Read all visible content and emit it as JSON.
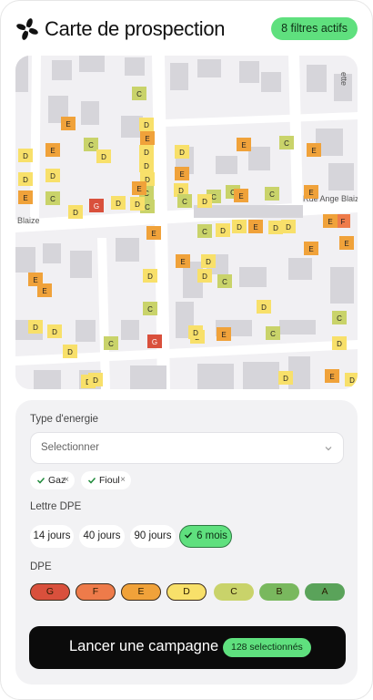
{
  "header": {
    "title": "Carte de prospection",
    "filters_badge": "8 filtres actifs"
  },
  "map": {
    "street_labels": [
      "Rue Ange Blaize",
      "Blaize",
      "ette"
    ],
    "building_tags": [
      {
        "letter": "C"
      },
      {
        "letter": "E"
      },
      {
        "letter": "C"
      },
      {
        "letter": "D"
      },
      {
        "letter": "E"
      },
      {
        "letter": "D"
      },
      {
        "letter": "D"
      },
      {
        "letter": "D"
      },
      {
        "letter": "D"
      },
      {
        "letter": "C"
      },
      {
        "letter": "C"
      },
      {
        "letter": "D"
      },
      {
        "letter": "E"
      },
      {
        "letter": "E"
      },
      {
        "letter": "D"
      },
      {
        "letter": "C"
      },
      {
        "letter": "D"
      },
      {
        "letter": "D"
      },
      {
        "letter": "E"
      },
      {
        "letter": "D"
      },
      {
        "letter": "C"
      },
      {
        "letter": "E"
      },
      {
        "letter": "D"
      },
      {
        "letter": "G"
      },
      {
        "letter": "D"
      },
      {
        "letter": "D"
      },
      {
        "letter": "C"
      },
      {
        "letter": "C"
      },
      {
        "letter": "E"
      },
      {
        "letter": "C"
      },
      {
        "letter": "E"
      },
      {
        "letter": "C"
      },
      {
        "letter": "E"
      },
      {
        "letter": "E"
      },
      {
        "letter": "D"
      },
      {
        "letter": "E"
      },
      {
        "letter": "F"
      },
      {
        "letter": "C"
      },
      {
        "letter": "D"
      },
      {
        "letter": "D"
      },
      {
        "letter": "E"
      },
      {
        "letter": "D"
      },
      {
        "letter": "D"
      },
      {
        "letter": "E"
      },
      {
        "letter": "E"
      },
      {
        "letter": "E"
      },
      {
        "letter": "E"
      },
      {
        "letter": "D"
      },
      {
        "letter": "D"
      },
      {
        "letter": "C"
      },
      {
        "letter": "D"
      },
      {
        "letter": "C"
      },
      {
        "letter": "E"
      },
      {
        "letter": "E"
      },
      {
        "letter": "D"
      },
      {
        "letter": "D"
      },
      {
        "letter": "D"
      },
      {
        "letter": "C"
      },
      {
        "letter": "G"
      },
      {
        "letter": "D"
      },
      {
        "letter": "E"
      },
      {
        "letter": "D"
      },
      {
        "letter": "C"
      },
      {
        "letter": "E"
      },
      {
        "letter": "D"
      },
      {
        "letter": "D"
      },
      {
        "letter": "D"
      },
      {
        "letter": "D"
      },
      {
        "letter": "D"
      },
      {
        "letter": "C"
      },
      {
        "letter": "D"
      }
    ]
  },
  "filters": {
    "energy_label": "Type d'energie",
    "energy_placeholder": "Selectionner",
    "energy_tags": [
      "Gaz",
      "Fioul"
    ],
    "dpe_letter_label": "Lettre DPE",
    "periods": [
      {
        "label": "14 jours",
        "active": false
      },
      {
        "label": "40 jours",
        "active": false
      },
      {
        "label": "90 jours",
        "active": false
      },
      {
        "label": "6 mois",
        "active": true
      }
    ],
    "dpe_label": "DPE",
    "dpe_classes": [
      {
        "letter": "G",
        "color": "#d9503c",
        "selected": true
      },
      {
        "letter": "F",
        "color": "#ee7b4a",
        "selected": true
      },
      {
        "letter": "E",
        "color": "#f0a23a",
        "selected": true
      },
      {
        "letter": "D",
        "color": "#f8e06a",
        "selected": true
      },
      {
        "letter": "C",
        "color": "#c9d36a",
        "selected": false
      },
      {
        "letter": "B",
        "color": "#79b85e",
        "selected": false
      },
      {
        "letter": "A",
        "color": "#5aa35a",
        "selected": false
      }
    ]
  },
  "cta": {
    "label": "Lancer une campagne",
    "count_badge": "128 selectionnés"
  },
  "colors": {
    "accent": "#5fe07e",
    "dpe_G": "#d9503c",
    "dpe_F": "#ee7b4a",
    "dpe_E": "#f0a23a",
    "dpe_D": "#f8e06a",
    "dpe_C": "#c9d36a",
    "dpe_B": "#79b85e",
    "dpe_A": "#5aa35a"
  }
}
